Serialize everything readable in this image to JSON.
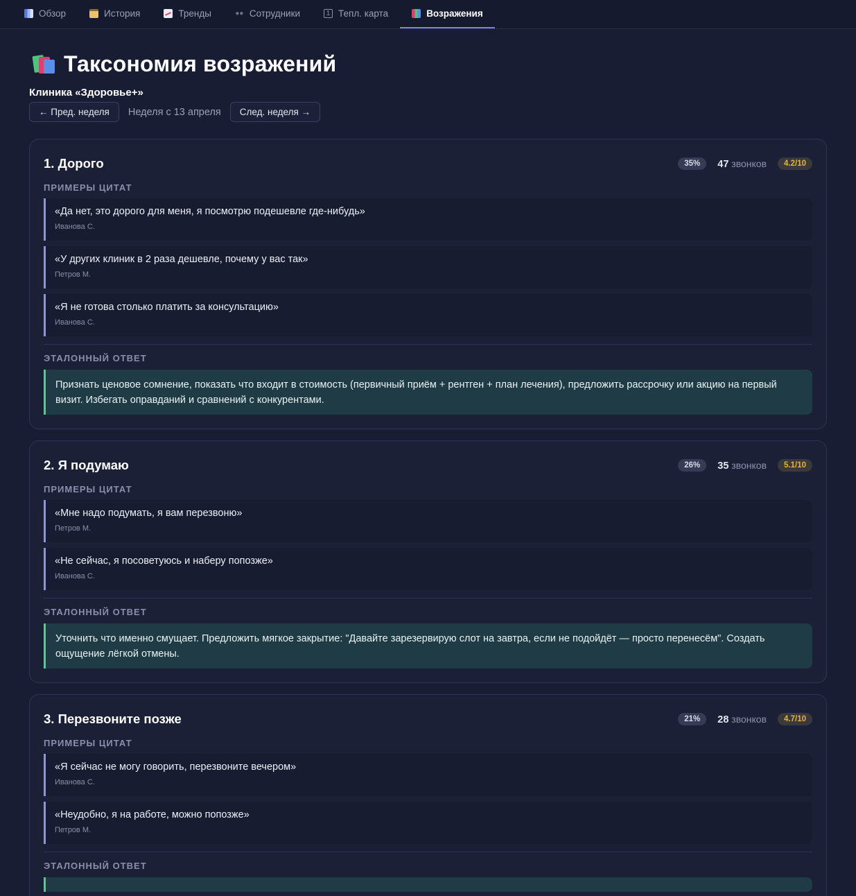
{
  "tabs": [
    {
      "label": "Обзор",
      "icon": "bar-chart-icon"
    },
    {
      "label": "История",
      "icon": "clipboard-icon"
    },
    {
      "label": "Тренды",
      "icon": "trend-icon"
    },
    {
      "label": "Сотрудники",
      "icon": "people-icon"
    },
    {
      "label": "Тепл. карта",
      "icon": "calendar-icon"
    },
    {
      "label": "Возражения",
      "icon": "books-icon",
      "active": true
    }
  ],
  "page": {
    "title": "Таксономия возражений",
    "clinic": "Клиника «Здоровье+»",
    "prev_week": "← Пред. неделя",
    "week_label": "Неделя с 13 апреля",
    "next_week": "След. неделя →"
  },
  "labels": {
    "quotes": "ПРИМЕРЫ ЦИТАТ",
    "answer": "ЭТАЛОННЫЙ ОТВЕТ",
    "calls_word": "звонков"
  },
  "objections": [
    {
      "title": "1. Дорого",
      "share": "35%",
      "calls": "47",
      "score": "4.2/10",
      "quotes": [
        {
          "text": "«Да нет, это дорого для меня, я посмотрю подешевле где-нибудь»",
          "author": "Иванова С."
        },
        {
          "text": "«У других клиник в 2 раза дешевле, почему у вас так»",
          "author": "Петров М."
        },
        {
          "text": "«Я не готова столько платить за консультацию»",
          "author": "Иванова С."
        }
      ],
      "answer": "Признать ценовое сомнение, показать что входит в стоимость (первичный приём + рентген + план лечения), предложить рассрочку или акцию на первый визит. Избегать оправданий и сравнений с конкурентами."
    },
    {
      "title": "2. Я подумаю",
      "share": "26%",
      "calls": "35",
      "score": "5.1/10",
      "quotes": [
        {
          "text": "«Мне надо подумать, я вам перезвоню»",
          "author": "Петров М."
        },
        {
          "text": "«Не сейчас, я посоветуюсь и наберу попозже»",
          "author": "Иванова С."
        }
      ],
      "answer": "Уточнить что именно смущает. Предложить мягкое закрытие: \"Давайте зарезервирую слот на завтра, если не подойдёт — просто перенесём\". Создать ощущение лёгкой отмены."
    },
    {
      "title": "3. Перезвоните позже",
      "share": "21%",
      "calls": "28",
      "score": "4.7/10",
      "quotes": [
        {
          "text": "«Я сейчас не могу говорить, перезвоните вечером»",
          "author": "Иванова С."
        },
        {
          "text": "«Неудобно, я на работе, можно попозже»",
          "author": "Петров М."
        }
      ],
      "answer": ""
    }
  ]
}
